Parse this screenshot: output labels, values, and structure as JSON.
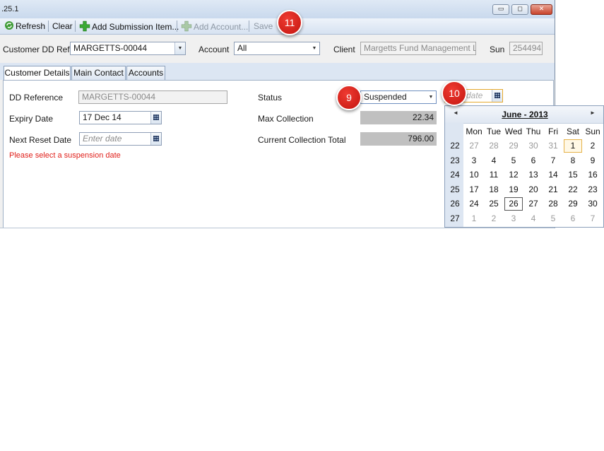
{
  "window": {
    "title": ".25.1"
  },
  "window_controls": {
    "minimize": "▭",
    "restore": "◻",
    "close": "✕"
  },
  "toolbar": {
    "refresh": "Refresh",
    "clear": "Clear",
    "add_submission": "Add Submission Item...",
    "add_account": "Add Account...",
    "save": "Save"
  },
  "filters": {
    "customer_dd_ref_label": "Customer DD Ref",
    "customer_dd_ref_value": "MARGETTS-00044",
    "account_label": "Account",
    "account_value": "All",
    "client_label": "Client",
    "client_value": "Margetts Fund Management Ltd",
    "sun_label": "Sun",
    "sun_value": "254494"
  },
  "tabs": [
    "Customer Details",
    "Main Contact",
    "Accounts"
  ],
  "details": {
    "dd_reference_label": "DD Reference",
    "dd_reference_value": "MARGETTS-00044",
    "expiry_date_label": "Expiry Date",
    "expiry_date_value": "17 Dec 14",
    "next_reset_label": "Next Reset Date",
    "next_reset_placeholder": "Enter date",
    "error_text": "Please select a suspension date",
    "status_label": "Status",
    "status_value": "Suspended",
    "suspension_placeholder": "date",
    "max_collection_label": "Max Collection",
    "max_collection_value": "22.34",
    "current_total_label": "Current Collection Total",
    "current_total_value": "796.00"
  },
  "callouts": {
    "c9": "9",
    "c10": "10",
    "c11": "11"
  },
  "calendar": {
    "title": "June - 2013",
    "prev": "◄",
    "next": "►",
    "days_of_week": [
      "Mon",
      "Tue",
      "Wed",
      "Thu",
      "Fri",
      "Sat",
      "Sun"
    ],
    "weeks": [
      {
        "week": "22",
        "days": [
          "27",
          "28",
          "29",
          "30",
          "31",
          "1",
          "2"
        ]
      },
      {
        "week": "23",
        "days": [
          "3",
          "4",
          "5",
          "6",
          "7",
          "8",
          "9"
        ]
      },
      {
        "week": "24",
        "days": [
          "10",
          "11",
          "12",
          "13",
          "14",
          "15",
          "16"
        ]
      },
      {
        "week": "25",
        "days": [
          "17",
          "18",
          "19",
          "20",
          "21",
          "22",
          "23"
        ]
      },
      {
        "week": "26",
        "days": [
          "24",
          "25",
          "26",
          "27",
          "28",
          "29",
          "30"
        ]
      },
      {
        "week": "27",
        "days": [
          "1",
          "2",
          "3",
          "4",
          "5",
          "6",
          "7"
        ]
      }
    ],
    "dim": [
      [
        true,
        true,
        true,
        true,
        true,
        false,
        false
      ],
      [
        false,
        false,
        false,
        false,
        false,
        false,
        false
      ],
      [
        false,
        false,
        false,
        false,
        false,
        false,
        false
      ],
      [
        false,
        false,
        false,
        false,
        false,
        false,
        false
      ],
      [
        false,
        false,
        false,
        false,
        false,
        false,
        false
      ],
      [
        true,
        true,
        true,
        true,
        true,
        true,
        true
      ]
    ],
    "selected_day": "1",
    "today_day": "26"
  },
  "colors": {
    "accent": "#c9d9ed",
    "error": "#e0201b",
    "callout": "#d01f17"
  }
}
